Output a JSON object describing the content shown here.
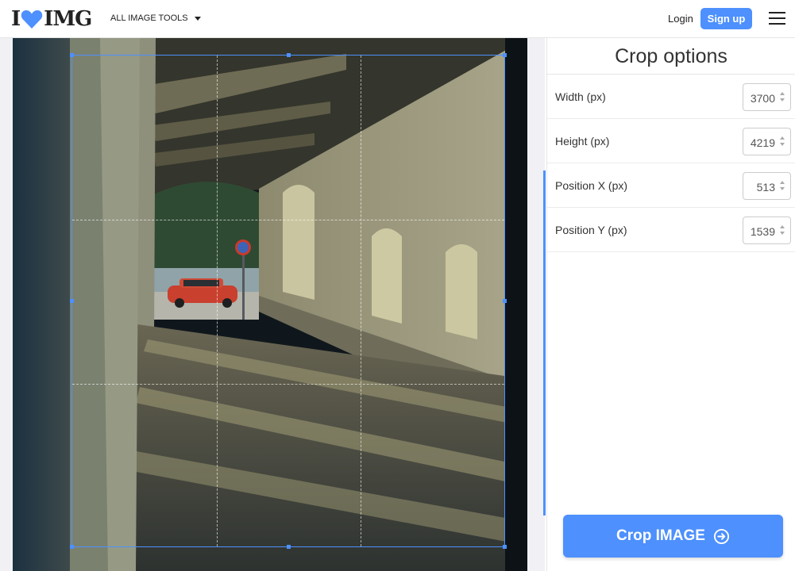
{
  "header": {
    "logo_left": "I",
    "logo_right": "IMG",
    "logo_heart_icon": "heart-icon",
    "tools_menu_label": "ALL IMAGE TOOLS",
    "login_label": "Login",
    "signup_label": "Sign up",
    "menu_icon": "hamburger-icon"
  },
  "sidebar": {
    "title": "Crop options",
    "fields": [
      {
        "label": "Width (px)",
        "value": "3700"
      },
      {
        "label": "Height (px)",
        "value": "4219"
      },
      {
        "label": "Position X (px)",
        "value": "513"
      },
      {
        "label": "Position Y (px)",
        "value": "1539"
      }
    ]
  },
  "action": {
    "label": "Crop IMAGE",
    "icon": "arrow-right-circle-icon"
  },
  "colors": {
    "accent": "#4d90fe"
  }
}
